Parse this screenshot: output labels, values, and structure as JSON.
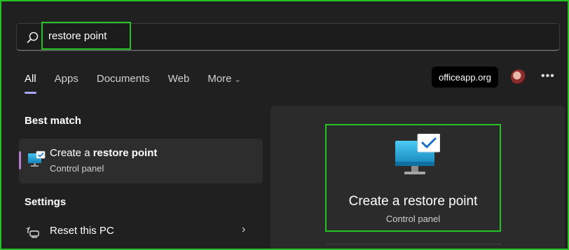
{
  "search": {
    "query": "restore point"
  },
  "tabs": [
    {
      "label": "All"
    },
    {
      "label": "Apps"
    },
    {
      "label": "Documents"
    },
    {
      "label": "Web"
    },
    {
      "label": "More"
    }
  ],
  "account": {
    "label": "officeapp.org"
  },
  "more_menu": {
    "label": "•••"
  },
  "best_match": {
    "heading": "Best match",
    "item": {
      "title_prefix": "Create a ",
      "title_bold": "restore point",
      "subtitle": "Control panel",
      "icon": "monitor-check-icon"
    }
  },
  "settings": {
    "heading": "Settings",
    "items": [
      {
        "label": "Reset this PC",
        "icon": "reset-pc-icon"
      }
    ]
  },
  "preview": {
    "title": "Create a restore point",
    "subtitle": "Control panel",
    "icon": "monitor-check-icon"
  },
  "colors": {
    "background": "#202020",
    "highlight": "#22c322",
    "tab_underline": "#a7a7ff"
  }
}
